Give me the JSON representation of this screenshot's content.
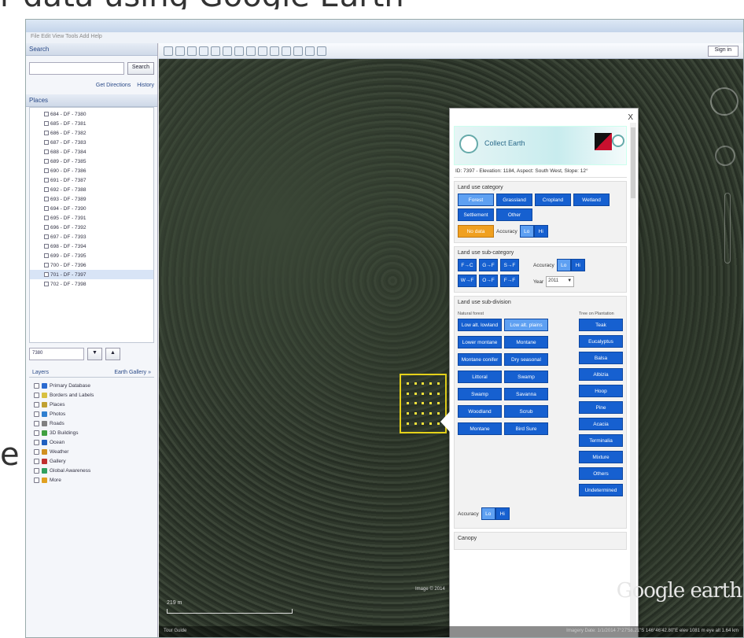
{
  "slide": {
    "top_fragment": "r data using Google Earth",
    "side_fragment": "e"
  },
  "window": {
    "menu": "File  Edit  View  Tools  Add  Help"
  },
  "search": {
    "header": "Search",
    "button": "Search",
    "get_directions": "Get Directions",
    "history": "History"
  },
  "places": {
    "header": "Places",
    "items": [
      "684 - DF - 7380",
      "685 - DF - 7381",
      "686 - DF - 7382",
      "687 - DF - 7383",
      "688 - DF - 7384",
      "689 - DF - 7385",
      "690 - DF - 7386",
      "691 - DF - 7387",
      "692 - DF - 7388",
      "693 - DF - 7389",
      "694 - DF - 7390",
      "695 - DF - 7391",
      "696 - DF - 7392",
      "697 - DF - 7393",
      "698 - DF - 7394",
      "699 - DF - 7395",
      "700 - DF - 7396",
      "701 - DF - 7397",
      "702 - DF - 7398"
    ],
    "selected_index": 17,
    "nav_value": "7380"
  },
  "layers": {
    "header": "Layers",
    "gallery": "Earth Gallery »",
    "items": [
      {
        "label": "Primary Database",
        "color": "#2a6ad0"
      },
      {
        "label": "Borders and Labels",
        "color": "#d8c040"
      },
      {
        "label": "Places",
        "color": "#c0a030"
      },
      {
        "label": "Photos",
        "color": "#3080d0"
      },
      {
        "label": "Roads",
        "color": "#808080"
      },
      {
        "label": "3D Buildings",
        "color": "#40a040"
      },
      {
        "label": "Ocean",
        "color": "#2060c0"
      },
      {
        "label": "Weather",
        "color": "#d09020"
      },
      {
        "label": "Gallery",
        "color": "#c03030"
      },
      {
        "label": "Global Awareness",
        "color": "#30a060"
      },
      {
        "label": "More",
        "color": "#e0a020"
      }
    ]
  },
  "toolbar": {
    "sign_in": "Sign in"
  },
  "map": {
    "scale": "219 m",
    "imagery": "Image © 2014",
    "status_left": "Tour Guide",
    "status_right": "Imagery Date: 1/1/2014   7°27'58.21\"S 146°46'42.80\"E   elev 1081 m   eye alt 1.64 km",
    "logo": "Google earth"
  },
  "balloon": {
    "close": "X",
    "banner_title": "Collect Earth",
    "id_line": "ID: 7397 - Elevation: 1184, Aspect: South West, Slope: 12°",
    "land_use": {
      "title": "Land use category",
      "buttons": [
        {
          "label": "Forest",
          "active": true
        },
        {
          "label": "Grassland",
          "active": false
        },
        {
          "label": "Cropland",
          "active": false
        },
        {
          "label": "Wetland",
          "active": false
        },
        {
          "label": "Settlement",
          "active": false
        },
        {
          "label": "Other",
          "active": false
        }
      ],
      "no_data": "No data",
      "accuracy_label": "Accuracy",
      "accuracy": [
        "Lo",
        "Hi"
      ]
    },
    "sub_category": {
      "title": "Land use sub-category",
      "buttons": [
        "F→C",
        "G→F",
        "S→F",
        "W→F",
        "O→F",
        "F→F"
      ],
      "accuracy_label": "Accuracy",
      "accuracy": [
        "Lo",
        "Hi"
      ],
      "year_label": "Year",
      "year_value": "2011"
    },
    "sub_division": {
      "title": "Land use sub-division",
      "col1_header": "Natural forest",
      "col1": [
        "Low alt. lowland",
        "Low alt. plains",
        "Lower montane",
        "Montane",
        "Montane conifer",
        "Dry seasonal",
        "Littoral",
        "Swamp",
        "Swamp",
        "Savanna",
        "Woodland",
        "Scrub",
        "Montane",
        "Bird Sure"
      ],
      "col2_header": "Tree on Plantation",
      "col2": [
        "Teak",
        "Eucalyptus",
        "Balsa",
        "Albizia",
        "Hoop",
        "Pine",
        "Acacia",
        "Terminalia",
        "Mixture",
        "Others",
        "Undetermined"
      ],
      "accuracy_label": "Accuracy",
      "accuracy": [
        "Lo",
        "Hi"
      ]
    },
    "next_section": "Canopy"
  }
}
